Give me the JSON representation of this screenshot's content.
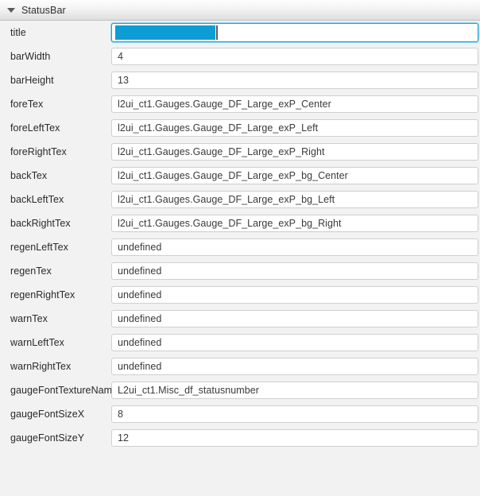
{
  "panel": {
    "title": "StatusBar",
    "collapse_icon": "triangle-down-icon",
    "expanded": true
  },
  "colors": {
    "background": "#f2f2f2",
    "header_border": "#bfbfbf",
    "field_border": "#cfcfcf",
    "focus_border": "#1ca0d8",
    "selection_fill": "#0d9cd4",
    "caret": "#5c5c5c",
    "label_text": "#2a2a2a",
    "value_text": "#3a3a3a"
  },
  "properties": [
    {
      "name": "title",
      "value": "",
      "focused": true,
      "selected": true
    },
    {
      "name": "barWidth",
      "value": "4",
      "focused": false,
      "selected": false
    },
    {
      "name": "barHeight",
      "value": "13",
      "focused": false,
      "selected": false
    },
    {
      "name": "foreTex",
      "value": "l2ui_ct1.Gauges.Gauge_DF_Large_exP_Center",
      "focused": false,
      "selected": false
    },
    {
      "name": "foreLeftTex",
      "value": "l2ui_ct1.Gauges.Gauge_DF_Large_exP_Left",
      "focused": false,
      "selected": false
    },
    {
      "name": "foreRightTex",
      "value": "l2ui_ct1.Gauges.Gauge_DF_Large_exP_Right",
      "focused": false,
      "selected": false
    },
    {
      "name": "backTex",
      "value": "l2ui_ct1.Gauges.Gauge_DF_Large_exP_bg_Center",
      "focused": false,
      "selected": false
    },
    {
      "name": "backLeftTex",
      "value": "l2ui_ct1.Gauges.Gauge_DF_Large_exP_bg_Left",
      "focused": false,
      "selected": false
    },
    {
      "name": "backRightTex",
      "value": "l2ui_ct1.Gauges.Gauge_DF_Large_exP_bg_Right",
      "focused": false,
      "selected": false
    },
    {
      "name": "regenLeftTex",
      "value": "undefined",
      "focused": false,
      "selected": false
    },
    {
      "name": "regenTex",
      "value": "undefined",
      "focused": false,
      "selected": false
    },
    {
      "name": "regenRightTex",
      "value": "undefined",
      "focused": false,
      "selected": false
    },
    {
      "name": "warnTex",
      "value": "undefined",
      "focused": false,
      "selected": false
    },
    {
      "name": "warnLeftTex",
      "value": "undefined",
      "focused": false,
      "selected": false
    },
    {
      "name": "warnRightTex",
      "value": "undefined",
      "focused": false,
      "selected": false
    },
    {
      "name": "gaugeFontTextureName",
      "value": "L2ui_ct1.Misc_df_statusnumber",
      "focused": false,
      "selected": false
    },
    {
      "name": "gaugeFontSizeX",
      "value": "8",
      "focused": false,
      "selected": false
    },
    {
      "name": "gaugeFontSizeY",
      "value": "12",
      "focused": false,
      "selected": false
    }
  ]
}
